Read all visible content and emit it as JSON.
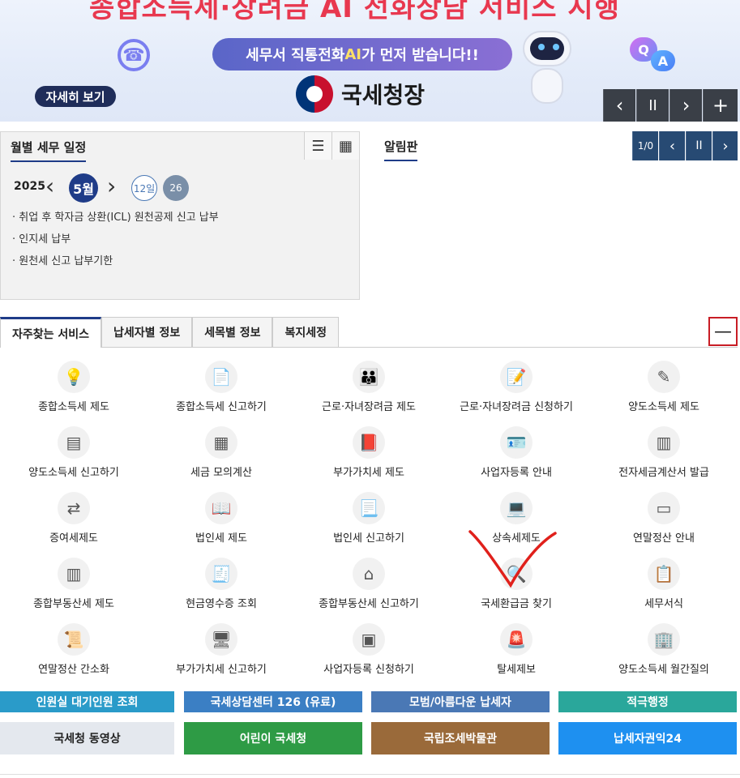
{
  "banner": {
    "headline": "종합소득세·장려금 AI 전화상담 서비스 시행",
    "pill_pre": "세무서 직통전화 ",
    "pill_ai": "AI",
    "pill_post": "가 먼저 받습니다!!",
    "logo_text": "국세청장",
    "detail_button": "자세히 보기",
    "qa_q": "Q",
    "qa_a": "A",
    "controls": {
      "prev": "‹",
      "pause": "II",
      "next": "›",
      "plus": "+"
    }
  },
  "schedule": {
    "title": "월별 세무 일정",
    "year": "2025",
    "prev": "‹",
    "next": "›",
    "month": "5월",
    "day1": "12일",
    "day2": "26",
    "list_icon": "☰",
    "calendar_icon": "▦",
    "items": [
      "· 취업 후 학자금 상환(ICL) 원천공제 신고 납부",
      "· 인지세 납부",
      "· 원천세 신고 납부기한"
    ]
  },
  "notice": {
    "title": "알림판",
    "page": "1/0",
    "prev": "‹",
    "pause": "II",
    "next": "›"
  },
  "services": {
    "tabs": [
      "자주찾는 서비스",
      "납세자별 정보",
      "세목별 정보",
      "복지세정"
    ],
    "collapse": "—",
    "items": [
      {
        "label": "종합소득세 제도",
        "icon": "person-bulb-icon"
      },
      {
        "label": "종합소득세 신고하기",
        "icon": "document-icon"
      },
      {
        "label": "근로·자녀장려금 제도",
        "icon": "family-icon"
      },
      {
        "label": "근로·자녀장려금 신청하기",
        "icon": "form-icon"
      },
      {
        "label": "양도소득세 제도",
        "icon": "edit-doc-icon"
      },
      {
        "label": "양도소득세 신고하기",
        "icon": "report-icon"
      },
      {
        "label": "세금 모의계산",
        "icon": "calculator-icon"
      },
      {
        "label": "부가가치세 제도",
        "icon": "book-icon"
      },
      {
        "label": "사업자등록 안내",
        "icon": "id-card-icon"
      },
      {
        "label": "전자세금계산서 발급",
        "icon": "device-icon"
      },
      {
        "label": "증여세제도",
        "icon": "exchange-people-icon"
      },
      {
        "label": "법인세 제도",
        "icon": "book-search-icon"
      },
      {
        "label": "법인세 신고하기",
        "icon": "doc-pen-icon"
      },
      {
        "label": "상속세제도",
        "icon": "laptop-icon"
      },
      {
        "label": "연말정산 안내",
        "icon": "screen-icon"
      },
      {
        "label": "종합부동산세 제도",
        "icon": "binders-icon"
      },
      {
        "label": "현금영수증 조회",
        "icon": "receipt-icon"
      },
      {
        "label": "종합부동산세 신고하기",
        "icon": "house-check-icon"
      },
      {
        "label": "국세환급금 찾기",
        "icon": "search-icon"
      },
      {
        "label": "세무서식",
        "icon": "forms-icon"
      },
      {
        "label": "연말정산 간소화",
        "icon": "scroll-check-icon"
      },
      {
        "label": "부가가치세 신고하기",
        "icon": "monitor-book-icon"
      },
      {
        "label": "사업자등록 신청하기",
        "icon": "card-icon"
      },
      {
        "label": "탈세제보",
        "icon": "siren-icon"
      },
      {
        "label": "양도소득세 월간질의",
        "icon": "building-icon"
      }
    ]
  },
  "bottom_links": {
    "row1": [
      {
        "label": "인원실 대기인원 조회",
        "color": "#2a9bc9"
      },
      {
        "label": "국세상담센터 126 (유료)",
        "color": "#3b7fc4"
      },
      {
        "label": "모범/아름다운 납세자",
        "color": "#4a78b5"
      },
      {
        "label": "적극행정",
        "color": "#2aa79b"
      }
    ],
    "row2": [
      {
        "label": "국세청 동영상",
        "color": "#e4e8ee"
      },
      {
        "label": "어린이 국세청",
        "color": "#2e9b45"
      },
      {
        "label": "국립조세박물관",
        "color": "#9a6a3a"
      },
      {
        "label": "납세자권익24",
        "color": "#1e90f0"
      }
    ]
  }
}
